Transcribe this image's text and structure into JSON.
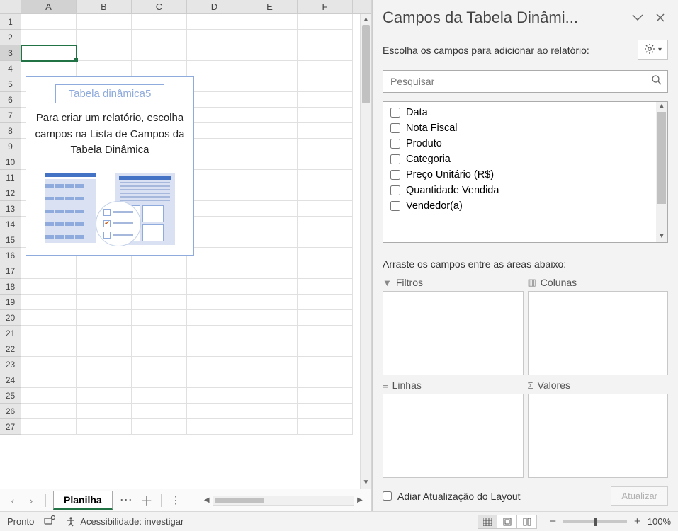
{
  "grid": {
    "columns": [
      "A",
      "B",
      "C",
      "D",
      "E",
      "F"
    ],
    "rows": [
      "1",
      "2",
      "3",
      "4",
      "5",
      "6",
      "7",
      "8",
      "9",
      "10",
      "11",
      "12",
      "13",
      "14",
      "15",
      "16",
      "17",
      "18",
      "19",
      "20",
      "21",
      "22",
      "23",
      "24",
      "25",
      "26",
      "27"
    ],
    "active_cell": "A3"
  },
  "pivot_placeholder": {
    "title": "Tabela dinâmica5",
    "text": "Para criar um relatório, escolha campos na Lista de Campos da Tabela Dinâmica"
  },
  "sheet_tabs": {
    "active": "Planilha"
  },
  "pane": {
    "title": "Campos da Tabela Dinâmi...",
    "subtitle": "Escolha os campos para adicionar ao relatório:",
    "search_placeholder": "Pesquisar",
    "fields": [
      "Data",
      "Nota Fiscal",
      "Produto",
      "Categoria",
      "Preço Unitário (R$)",
      "Quantidade Vendida",
      "Vendedor(a)"
    ],
    "drag_label": "Arraste os campos entre as áreas abaixo:",
    "areas": {
      "filters": "Filtros",
      "columns": "Colunas",
      "rows": "Linhas",
      "values": "Valores"
    },
    "defer_label": "Adiar Atualização do Layout",
    "update_label": "Atualizar"
  },
  "statusbar": {
    "ready": "Pronto",
    "accessibility": "Acessibilidade: investigar",
    "zoom": "100%"
  }
}
